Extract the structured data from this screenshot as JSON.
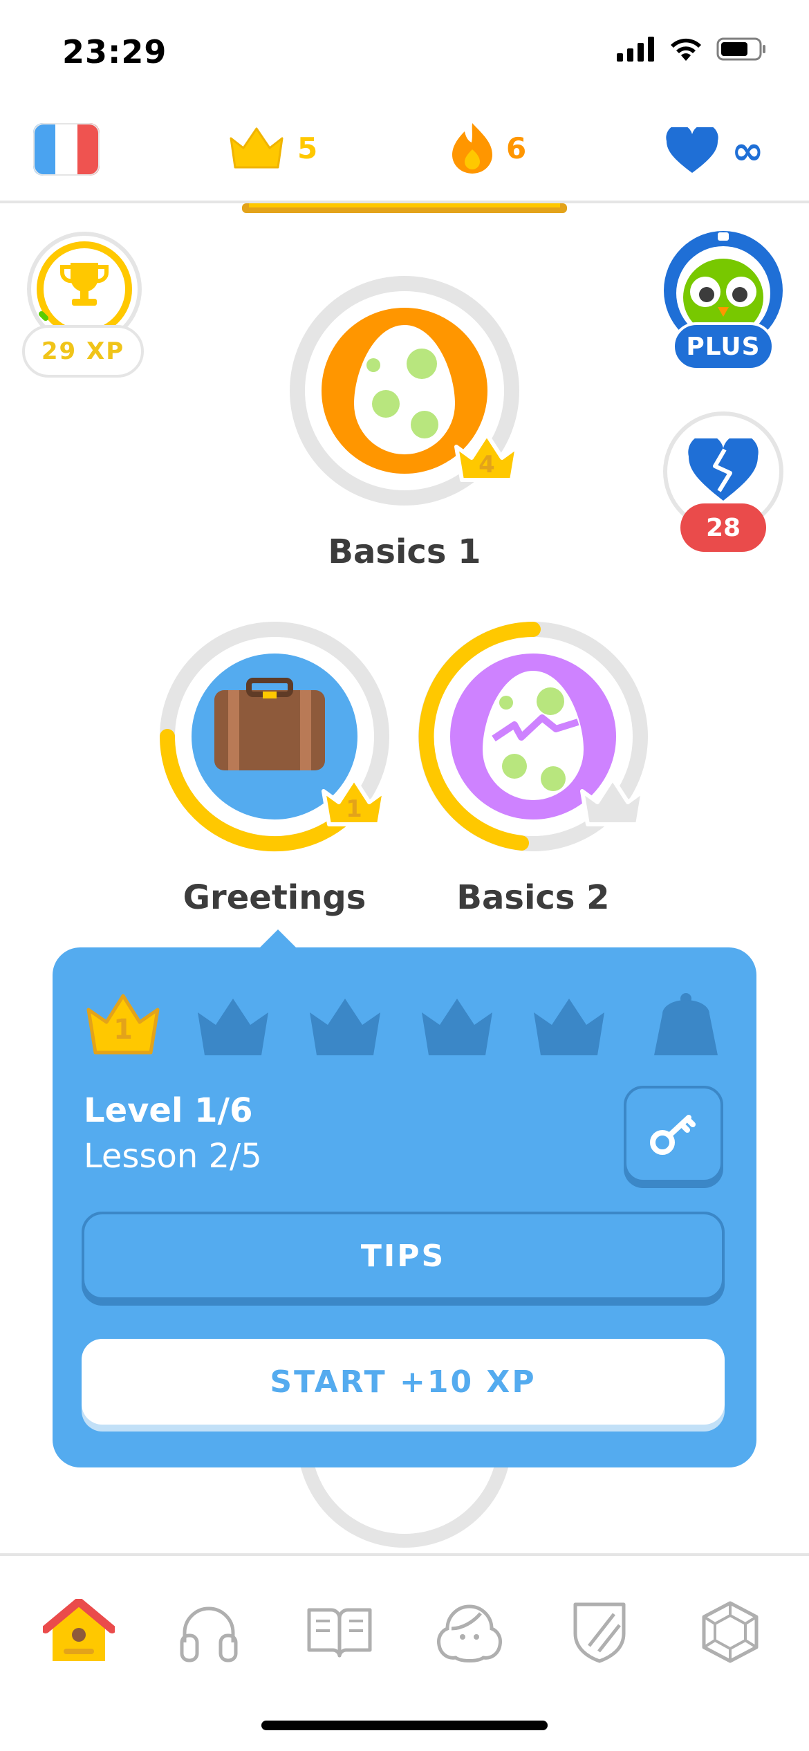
{
  "status_bar": {
    "time": "23:29"
  },
  "top_bar": {
    "language": "French",
    "crowns": "5",
    "streak": "6",
    "hearts": "∞"
  },
  "xp_badge": {
    "label": "29 XP"
  },
  "plus_badge": {
    "label": "PLUS"
  },
  "hearts_badge": {
    "count": "28"
  },
  "skills": [
    {
      "name": "Basics 1",
      "crown_level": "4"
    },
    {
      "name": "Greetings",
      "crown_level": "1"
    },
    {
      "name": "Basics 2",
      "crown_level": ""
    }
  ],
  "popover": {
    "crown_level": "1",
    "level": "Level 1/6",
    "lesson": "Lesson 2/5",
    "tips_label": "TIPS",
    "start_label": "START +10 XP"
  },
  "colors": {
    "blue": "#54abef",
    "gold": "#ffc800",
    "orange": "#ff9600",
    "green": "#58cc02",
    "red": "#ea4b4b"
  },
  "nav": [
    "home-icon",
    "headphones-icon",
    "book-icon",
    "profile-icon",
    "shield-icon",
    "gem-icon"
  ]
}
